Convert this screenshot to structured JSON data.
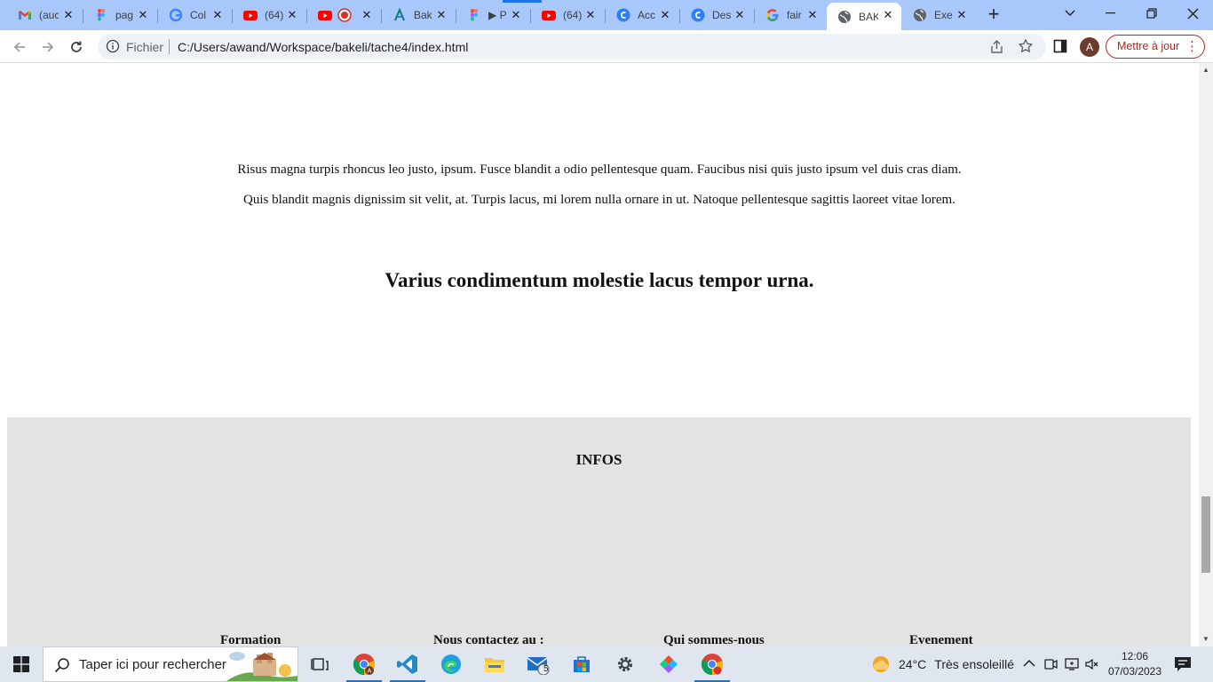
{
  "browser": {
    "tabs": [
      {
        "title": "(auc",
        "icon": "gmail-icon"
      },
      {
        "title": "pag",
        "icon": "figma-icon"
      },
      {
        "title": "Col",
        "icon": "google-g-icon"
      },
      {
        "title": "(64)",
        "icon": "youtube-icon"
      },
      {
        "title": "",
        "icon": "youtube-icon"
      },
      {
        "title": "Bak",
        "icon": "bakeli-icon"
      },
      {
        "title": "▶ P",
        "icon": "figma-icon"
      },
      {
        "title": "(64)",
        "icon": "youtube-icon"
      },
      {
        "title": "Acc",
        "icon": "canva-icon"
      },
      {
        "title": "Des",
        "icon": "canva-icon"
      },
      {
        "title": "fair",
        "icon": "google-g-icon"
      },
      {
        "title": "BAK",
        "icon": "globe-icon",
        "active": true
      },
      {
        "title": "Exe",
        "icon": "globe-icon"
      }
    ],
    "address": {
      "scheme_label": "Fichier",
      "url": "C:/Users/awand/Workspace/bakeli/tache4/index.html"
    },
    "profile_initial": "A",
    "update_label": "Mettre à jour"
  },
  "page": {
    "paragraphs": [
      "Risus magna turpis rhoncus leo justo, ipsum. Fusce blandit a odio pellentesque quam. Faucibus nisi quis justo ipsum vel duis cras diam.",
      "Quis blandit magnis dignissim sit velit, at. Turpis lacus, mi lorem nulla ornare in ut. Natoque pellentesque sagittis laoreet vitae lorem."
    ],
    "heading": "Varius condimentum molestie lacus tempor urna.",
    "footer": {
      "title": "INFOS",
      "columns": [
        "Formation",
        "Nous contactez au :",
        "Qui sommes-nous",
        "Evenement"
      ]
    }
  },
  "taskbar": {
    "search_placeholder": "Taper ici pour rechercher",
    "mail_badge": "5",
    "weather": {
      "temp": "24°C",
      "condition": "Très ensoleillé"
    },
    "clock": {
      "time": "12:06",
      "date": "07/03/2023"
    }
  },
  "colors": {
    "tabstrip": "#a8c7fa",
    "footer_bg": "#e4e3e1",
    "update_accent": "#b3261e",
    "taskbar": "#dfe6f0"
  }
}
